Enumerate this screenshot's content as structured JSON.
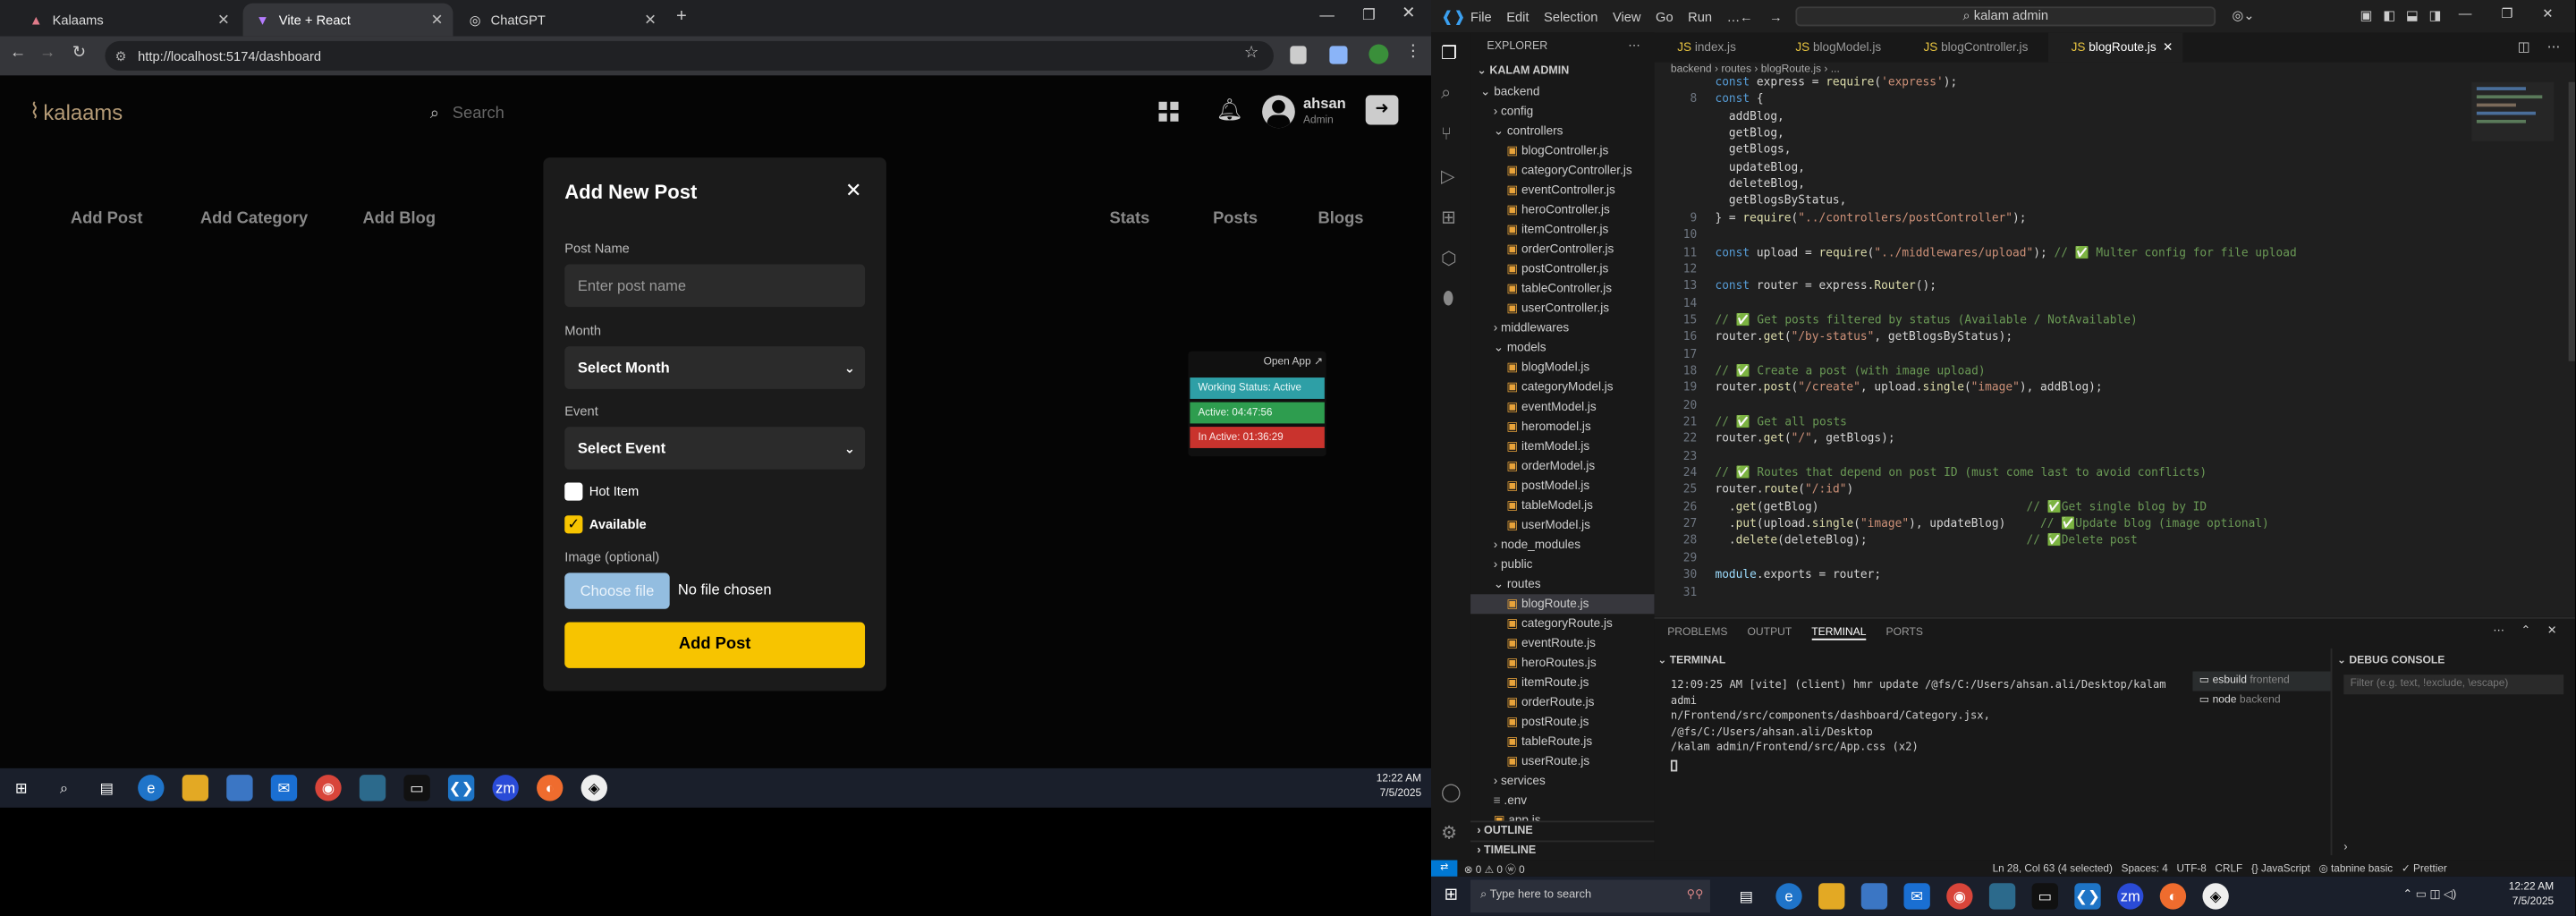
{
  "browser": {
    "tabs": [
      {
        "title": "Kalaams"
      },
      {
        "title": "Vite + React",
        "active": true
      },
      {
        "title": "ChatGPT"
      }
    ],
    "url": "http://localhost:5174/dashboard"
  },
  "app": {
    "logo": "kalaams",
    "search_placeholder": "Search",
    "user": {
      "name": "ahsan",
      "role": "Admin"
    },
    "nav_left": [
      "Add Post",
      "Add Category",
      "Add Blog"
    ],
    "nav_right": [
      "Stats",
      "Posts",
      "Blogs"
    ],
    "widget": {
      "open_app": "Open App ↗",
      "working": "Working Status: Active",
      "active": "Active: 04:47:56",
      "inactive": "In Active: 01:36:29"
    }
  },
  "modal": {
    "title": "Add New Post",
    "post_name_label": "Post Name",
    "post_name_placeholder": "Enter post name",
    "month_label": "Month",
    "month_value": "Select Month",
    "event_label": "Event",
    "event_value": "Select Event",
    "hot_item": "Hot Item",
    "hot_item_checked": false,
    "available": "Available",
    "available_checked": true,
    "image_label": "Image (optional)",
    "choose_file": "Choose file",
    "no_file": "No file chosen",
    "submit": "Add Post"
  },
  "taskbar_left": {
    "time": "12:22 AM",
    "date": "7/5/2025"
  },
  "vscode": {
    "menu": [
      "File",
      "Edit",
      "Selection",
      "View",
      "Go",
      "Run",
      "…"
    ],
    "search": "kalam admin",
    "explorer_title": "EXPLORER",
    "root": "KALAM ADMIN",
    "tree": [
      {
        "name": "backend",
        "depth": 1,
        "type": "folder-open"
      },
      {
        "name": "config",
        "depth": 2,
        "type": "folder"
      },
      {
        "name": "controllers",
        "depth": 2,
        "type": "folder-open"
      },
      {
        "name": "blogController.js",
        "depth": 3,
        "type": "js"
      },
      {
        "name": "categoryController.js",
        "depth": 3,
        "type": "js"
      },
      {
        "name": "eventController.js",
        "depth": 3,
        "type": "js"
      },
      {
        "name": "heroController.js",
        "depth": 3,
        "type": "js"
      },
      {
        "name": "itemController.js",
        "depth": 3,
        "type": "js"
      },
      {
        "name": "orderController.js",
        "depth": 3,
        "type": "js"
      },
      {
        "name": "postController.js",
        "depth": 3,
        "type": "js"
      },
      {
        "name": "tableController.js",
        "depth": 3,
        "type": "js"
      },
      {
        "name": "userController.js",
        "depth": 3,
        "type": "js"
      },
      {
        "name": "middlewares",
        "depth": 2,
        "type": "folder"
      },
      {
        "name": "models",
        "depth": 2,
        "type": "folder-open"
      },
      {
        "name": "blogModel.js",
        "depth": 3,
        "type": "js"
      },
      {
        "name": "categoryModel.js",
        "depth": 3,
        "type": "js"
      },
      {
        "name": "eventModel.js",
        "depth": 3,
        "type": "js"
      },
      {
        "name": "heromodel.js",
        "depth": 3,
        "type": "js"
      },
      {
        "name": "itemModel.js",
        "depth": 3,
        "type": "js"
      },
      {
        "name": "orderModel.js",
        "depth": 3,
        "type": "js"
      },
      {
        "name": "postModel.js",
        "depth": 3,
        "type": "js"
      },
      {
        "name": "tableModel.js",
        "depth": 3,
        "type": "js"
      },
      {
        "name": "userModel.js",
        "depth": 3,
        "type": "js"
      },
      {
        "name": "node_modules",
        "depth": 2,
        "type": "folder"
      },
      {
        "name": "public",
        "depth": 2,
        "type": "folder"
      },
      {
        "name": "routes",
        "depth": 2,
        "type": "folder-open"
      },
      {
        "name": "blogRoute.js",
        "depth": 3,
        "type": "js",
        "selected": true
      },
      {
        "name": "categoryRoute.js",
        "depth": 3,
        "type": "js"
      },
      {
        "name": "eventRoute.js",
        "depth": 3,
        "type": "js"
      },
      {
        "name": "heroRoutes.js",
        "depth": 3,
        "type": "js"
      },
      {
        "name": "itemRoute.js",
        "depth": 3,
        "type": "js"
      },
      {
        "name": "orderRoute.js",
        "depth": 3,
        "type": "js"
      },
      {
        "name": "postRoute.js",
        "depth": 3,
        "type": "js"
      },
      {
        "name": "tableRoute.js",
        "depth": 3,
        "type": "js"
      },
      {
        "name": "userRoute.js",
        "depth": 3,
        "type": "js"
      },
      {
        "name": "services",
        "depth": 2,
        "type": "folder"
      },
      {
        "name": ".env",
        "depth": 2,
        "type": "file"
      },
      {
        "name": "app.js",
        "depth": 2,
        "type": "js"
      }
    ],
    "outline": "OUTLINE",
    "timeline": "TIMELINE",
    "tabs": [
      {
        "name": "index.js"
      },
      {
        "name": "blogModel.js"
      },
      {
        "name": "blogController.js"
      },
      {
        "name": "blogRoute.js",
        "active": true
      }
    ],
    "breadcrumb": "backend › routes › blogRoute.js › ...",
    "code": [
      {
        "n": "",
        "t": "const express = require('express');"
      },
      {
        "n": "8",
        "t": "const {"
      },
      {
        "n": "",
        "t": "  addBlog,"
      },
      {
        "n": "",
        "t": "  getBlog,"
      },
      {
        "n": "",
        "t": "  getBlogs,"
      },
      {
        "n": "",
        "t": "  updateBlog,"
      },
      {
        "n": "",
        "t": "  deleteBlog,"
      },
      {
        "n": "",
        "t": "  getBlogsByStatus,"
      },
      {
        "n": "9",
        "t": "} = require(\"../controllers/postController\");"
      },
      {
        "n": "10",
        "t": ""
      },
      {
        "n": "11",
        "t": "const upload = require(\"../middlewares/upload\"); // ✅ Multer config for file upload"
      },
      {
        "n": "12",
        "t": ""
      },
      {
        "n": "13",
        "t": "const router = express.Router();"
      },
      {
        "n": "14",
        "t": ""
      },
      {
        "n": "15",
        "t": "// ✅ Get posts filtered by status (Available / NotAvailable)"
      },
      {
        "n": "16",
        "t": "router.get(\"/by-status\", getBlogsByStatus);"
      },
      {
        "n": "17",
        "t": ""
      },
      {
        "n": "18",
        "t": "// ✅ Create a post (with image upload)"
      },
      {
        "n": "19",
        "t": "router.post(\"/create\", upload.single(\"image\"), addBlog);"
      },
      {
        "n": "20",
        "t": ""
      },
      {
        "n": "21",
        "t": "// ✅ Get all posts"
      },
      {
        "n": "22",
        "t": "router.get(\"/\", getBlogs);"
      },
      {
        "n": "23",
        "t": ""
      },
      {
        "n": "24",
        "t": "// ✅ Routes that depend on post ID (must come last to avoid conflicts)"
      },
      {
        "n": "25",
        "t": "router.route(\"/:id\")"
      },
      {
        "n": "26",
        "t": "  .get(getBlog)                              // ✅Get single blog by ID"
      },
      {
        "n": "27",
        "t": "  .put(upload.single(\"image\"), updateBlog)     // ✅Update blog (image optional)"
      },
      {
        "n": "28",
        "t": "  .delete(deleteBlog);                       // ✅Delete post"
      },
      {
        "n": "29",
        "t": ""
      },
      {
        "n": "30",
        "t": "module.exports = router;"
      },
      {
        "n": "31",
        "t": ""
      }
    ],
    "panel_tabs": [
      "PROBLEMS",
      "OUTPUT",
      "TERMINAL",
      "PORTS"
    ],
    "terminal_title": "TERMINAL",
    "terminal_lines": [
      "12:09:25 AM [vite] (client) hmr update /@fs/C:/Users/ahsan.ali/Desktop/kalam admi",
      "n/Frontend/src/components/dashboard/Category.jsx, /@fs/C:/Users/ahsan.ali/Desktop",
      "/kalam admin/Frontend/src/App.css (x2)"
    ],
    "terminals": [
      {
        "name": "esbuild",
        "sub": "frontend"
      },
      {
        "name": "node",
        "sub": "backend"
      }
    ],
    "debug_title": "DEBUG CONSOLE",
    "debug_filter": "Filter (e.g. text, !exclude, \\escape)",
    "status_left": "⊗ 0 ⚠ 0  ⓦ 0",
    "status_right": "Ln 28, Col 63 (4 selected)   Spaces: 4   UTF-8   CRLF   {} JavaScript   ◎ tabnine basic   ✓ Prettier",
    "taskbar_search": "Type here to search",
    "time": "12:22 AM",
    "date": "7/5/2025"
  }
}
